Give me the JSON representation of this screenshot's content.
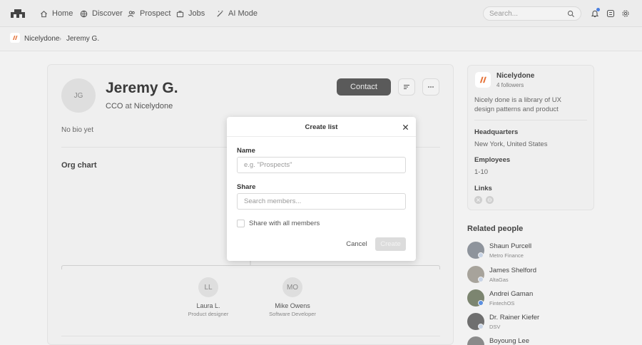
{
  "nav": {
    "items": [
      {
        "label": "Home",
        "icon": "home-icon"
      },
      {
        "label": "Discover",
        "icon": "globe-icon"
      },
      {
        "label": "Prospect",
        "icon": "people-icon"
      },
      {
        "label": "Jobs",
        "icon": "briefcase-icon"
      },
      {
        "label": "AI Mode",
        "icon": "wand-icon"
      }
    ],
    "search_placeholder": "Search..."
  },
  "breadcrumb": {
    "company": "Nicelydone",
    "person": "Jeremy G."
  },
  "profile": {
    "initials": "JG",
    "name": "Jeremy G.",
    "role": "CCO",
    "at": "at",
    "company": "Nicelydone",
    "contact_label": "Contact",
    "bio": "No bio yet",
    "org_chart_title": "Org chart"
  },
  "org_nodes": [
    {
      "initials": "LL",
      "name": "Laura L.",
      "title": "Product designer"
    },
    {
      "initials": "MO",
      "name": "Mike Owens",
      "title": "Software Developer"
    }
  ],
  "company_card": {
    "name": "Nicelydone",
    "followers": "4 followers",
    "description": "Nicely done is a library of UX design patterns and product inspiration. It…",
    "hq_label": "Headquarters",
    "hq_value": "New York, United States",
    "employees_label": "Employees",
    "employees_value": "1-10",
    "links_label": "Links"
  },
  "related": {
    "title": "Related people",
    "people": [
      {
        "name": "Shaun Purcell",
        "company": "Metro Finance",
        "color": "#8e949c"
      },
      {
        "name": "James Shelford",
        "company": "AltaGas",
        "color": "#a7a39b"
      },
      {
        "name": "Andrei Gaman",
        "company": "FintechOS",
        "color": "#7c8570"
      },
      {
        "name": "Dr. Rainer Kiefer",
        "company": "DSV",
        "color": "#6f6f6f"
      },
      {
        "name": "Boyoung Lee",
        "company": "",
        "color": "#8a8a8a"
      }
    ]
  },
  "modal": {
    "title": "Create list",
    "name_label": "Name",
    "name_placeholder": "e.g. \"Prospects\"",
    "share_label": "Share",
    "share_placeholder": "Search members...",
    "share_all_label": "Share with all members",
    "cancel_label": "Cancel",
    "create_label": "Create"
  }
}
